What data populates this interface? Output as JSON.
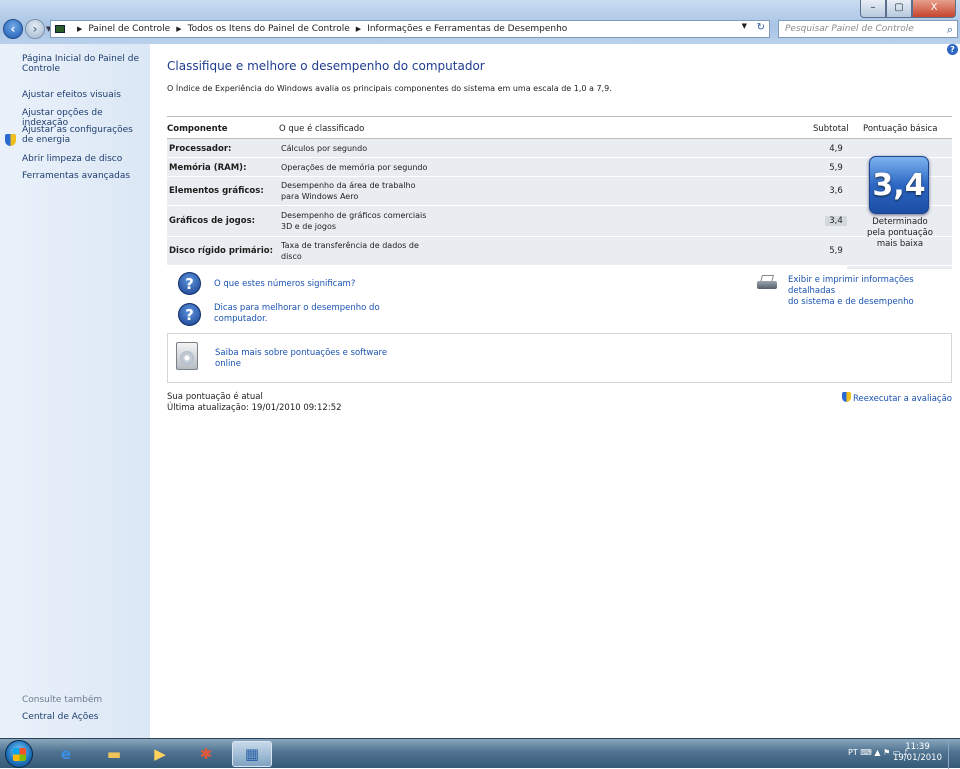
{
  "window": {
    "address": [
      "Painel de Controle",
      "Todos os Itens do Painel de Controle",
      "Informações e Ferramentas de Desempenho"
    ],
    "search_placeholder": "Pesquisar Painel de Controle",
    "controls": {
      "minimize": "–",
      "maximize": "▢",
      "close": "X"
    }
  },
  "sidebar": {
    "items": [
      {
        "label": "Página Inicial do Painel de Controle"
      },
      {
        "label": "Ajustar efeitos visuais"
      },
      {
        "label": "Ajustar opções de indexação"
      },
      {
        "label": "Ajustar as configurações de energia"
      },
      {
        "label": "Abrir limpeza de disco"
      },
      {
        "label": "Ferramentas avançadas"
      }
    ],
    "see_also_label": "Consulte também",
    "see_also_items": [
      {
        "label": "Central de Ações"
      }
    ]
  },
  "main": {
    "title": "Classifique e melhore o desempenho do computador",
    "subtitle": "O Índice de Experiência do Windows avalia os principais componentes do sistema em uma escala de 1,0 a 7,9.",
    "table": {
      "headers": {
        "component": "Componente",
        "rated": "O que é classificado",
        "subtotal": "Subtotal",
        "base": "Pontuação básica"
      },
      "rows": [
        {
          "component": "Processador:",
          "desc1": "Cálculos por segundo",
          "desc2": "",
          "subtotal": "4,9"
        },
        {
          "component": "Memória (RAM):",
          "desc1": "Operações de memória por segundo",
          "desc2": "",
          "subtotal": "5,9"
        },
        {
          "component": "Elementos gráficos:",
          "desc1": "Desempenho da área de trabalho",
          "desc2": "para Windows Aero",
          "subtotal": "3,6"
        },
        {
          "component": "Gráficos de jogos:",
          "desc1": "Desempenho de gráficos comerciais",
          "desc2": "3D e de jogos",
          "subtotal": "3,4"
        },
        {
          "component": "Disco rígido primário:",
          "desc1": "Taxa de transferência de dados de",
          "desc2": "disco",
          "subtotal": "5,9"
        }
      ],
      "base_score": "3,4",
      "base_text": [
        "Determinado",
        "pela pontuação",
        "mais baixa"
      ]
    },
    "links": {
      "what_numbers": "O que estes números significam?",
      "tips_1": "Dicas para melhorar o desempenho do",
      "tips_2": "computador.",
      "print_1": "Exibir e imprimir informações detalhadas",
      "print_2": "do sistema e de desempenho",
      "learn_1": "Saiba mais sobre pontuações e software",
      "learn_2": "online"
    },
    "status": {
      "current": "Sua pontuação é atual",
      "last_update": "Última atualização: 19/01/2010 09:12:52",
      "rerun": "Reexecutar a avaliação"
    }
  },
  "taskbar": {
    "apps": [
      "ie-icon",
      "explorer-icon",
      "media-player-icon",
      "control-panel-icon",
      "performance-icon"
    ],
    "language": "PT",
    "time": "11:39",
    "date": "19/01/2010"
  },
  "colors": {
    "accent": "#1e3d8f",
    "link": "#1a53b0",
    "badge": "#2c67c3"
  }
}
